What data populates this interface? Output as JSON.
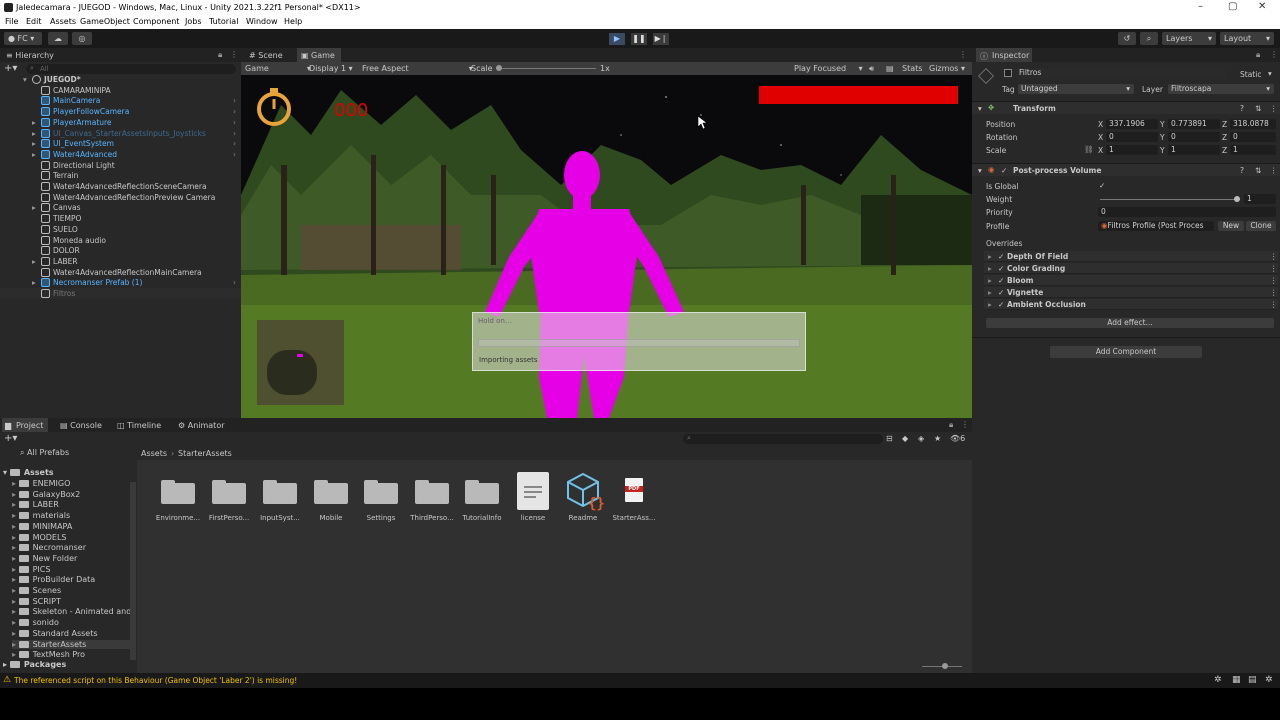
{
  "window": {
    "title": "Jaledecamara - JUEGOD - Windows, Mac, Linux - Unity 2021.3.22f1 Personal* <DX11>",
    "controls": [
      "–",
      "▢",
      "✕"
    ]
  },
  "menu": [
    "File",
    "Edit",
    "Assets",
    "GameObject",
    "Component",
    "Jobs",
    "Tutorial",
    "Window",
    "Help"
  ],
  "toolbar": {
    "account": "FC",
    "layers": "Layers",
    "layout": "Layout"
  },
  "hierarchy": {
    "tab": "Hierarchy",
    "search_placeholder": "All",
    "items": [
      {
        "label": "JUEGOD*",
        "indent": 0,
        "kind": "scene"
      },
      {
        "label": "CAMARAMINIPA",
        "indent": 1,
        "kind": "obj"
      },
      {
        "label": "MainCamera",
        "indent": 1,
        "kind": "prefab"
      },
      {
        "label": "PlayerFollowCamera",
        "indent": 1,
        "kind": "prefab"
      },
      {
        "label": "PlayerArmature",
        "indent": 1,
        "kind": "prefab"
      },
      {
        "label": "UI_Canvas_StarterAssetsInputs_Joysticks",
        "indent": 1,
        "kind": "prefab-dim"
      },
      {
        "label": "UI_EventSystem",
        "indent": 1,
        "kind": "prefab"
      },
      {
        "label": "Water4Advanced",
        "indent": 1,
        "kind": "prefab"
      },
      {
        "label": "Directional Light",
        "indent": 1,
        "kind": "obj"
      },
      {
        "label": "Terrain",
        "indent": 1,
        "kind": "obj"
      },
      {
        "label": "Water4AdvancedReflectionSceneCamera",
        "indent": 1,
        "kind": "obj"
      },
      {
        "label": "Water4AdvancedReflectionPreview Camera",
        "indent": 1,
        "kind": "obj"
      },
      {
        "label": "Canvas",
        "indent": 1,
        "kind": "obj"
      },
      {
        "label": "TIEMPO",
        "indent": 1,
        "kind": "obj"
      },
      {
        "label": "SUELO",
        "indent": 1,
        "kind": "obj"
      },
      {
        "label": "Moneda audio",
        "indent": 1,
        "kind": "obj"
      },
      {
        "label": "DOLOR",
        "indent": 1,
        "kind": "obj"
      },
      {
        "label": "LABER",
        "indent": 1,
        "kind": "obj"
      },
      {
        "label": "Water4AdvancedReflectionMainCamera",
        "indent": 1,
        "kind": "obj"
      },
      {
        "label": "Necromanser Prefab (1)",
        "indent": 1,
        "kind": "prefab"
      },
      {
        "label": "Filtros",
        "indent": 1,
        "kind": "selected"
      }
    ]
  },
  "center": {
    "tabs": [
      "Scene",
      "Game"
    ],
    "game_toolbar": {
      "mode": "Game",
      "display": "Display 1",
      "aspect": "Free Aspect",
      "scale_label": "Scale",
      "scale_value": "1x",
      "play_focused": "Play Focused",
      "stats": "Stats",
      "gizmos": "Gizmos"
    },
    "hud": {
      "counter": "000"
    },
    "progress_dialog": {
      "title": "Hold on...",
      "message": "Importing assets"
    }
  },
  "inspector": {
    "tab": "Inspector",
    "object_name": "Filtros",
    "static_label": "Static",
    "tag_label": "Tag",
    "tag_value": "Untagged",
    "layer_label": "Layer",
    "layer_value": "Filtroscapa",
    "transform": {
      "title": "Transform",
      "position_label": "Position",
      "rotation_label": "Rotation",
      "scale_label": "Scale",
      "position": {
        "x": "337.1906",
        "y": "0.773891",
        "z": "318.0878"
      },
      "rotation": {
        "x": "0",
        "y": "0",
        "z": "0"
      },
      "scale": {
        "x": "1",
        "y": "1",
        "z": "1"
      }
    },
    "post_process": {
      "title": "Post-process Volume",
      "is_global_label": "Is Global",
      "weight_label": "Weight",
      "weight_value": "1",
      "priority_label": "Priority",
      "priority_value": "0",
      "profile_label": "Profile",
      "profile_value": "Filtros Profile (Post Proces",
      "new_button": "New",
      "clone_button": "Clone",
      "overrides_label": "Overrides",
      "overrides": [
        "Depth Of Field",
        "Color Grading",
        "Bloom",
        "Vignette",
        "Ambient Occlusion"
      ],
      "add_effect": "Add effect..."
    },
    "add_component": "Add Component"
  },
  "project": {
    "tabs": [
      "Project",
      "Console",
      "Timeline",
      "Animator"
    ],
    "all_prefabs": "All Prefabs",
    "breadcrumb": [
      "Assets",
      "StarterAssets"
    ],
    "tree_root": "Assets",
    "tree": [
      "ENEMIGO",
      "GalaxyBox2",
      "LABER",
      "materials",
      "MINIMAPA",
      "MODELS",
      "Necromanser",
      "New Folder",
      "PICS",
      "ProBuilder Data",
      "Scenes",
      "SCRIPT",
      "Skeleton - Animated and I",
      "sonido",
      "Standard Assets",
      "StarterAssets",
      "TextMesh Pro"
    ],
    "packages": "Packages",
    "hidden_count": "6",
    "assets": [
      {
        "label": "Environme...",
        "kind": "folder"
      },
      {
        "label": "FirstPerso...",
        "kind": "folder"
      },
      {
        "label": "InputSyst...",
        "kind": "folder"
      },
      {
        "label": "Mobile",
        "kind": "folder"
      },
      {
        "label": "Settings",
        "kind": "folder"
      },
      {
        "label": "ThirdPerso...",
        "kind": "folder"
      },
      {
        "label": "TutorialInfo",
        "kind": "folder"
      },
      {
        "label": "license",
        "kind": "doc"
      },
      {
        "label": "Readme",
        "kind": "readme"
      },
      {
        "label": "StarterAss...",
        "kind": "pdf"
      }
    ]
  },
  "status": {
    "message": "The referenced script on this Behaviour (Game Object 'Laber 2') is missing!"
  },
  "colors": {
    "accent_blue": "#5ab4ff",
    "magenta": "#e600e6",
    "health_red": "#e00000",
    "timer_orange": "#e8a33a",
    "warning_yellow": "#f0c000"
  }
}
